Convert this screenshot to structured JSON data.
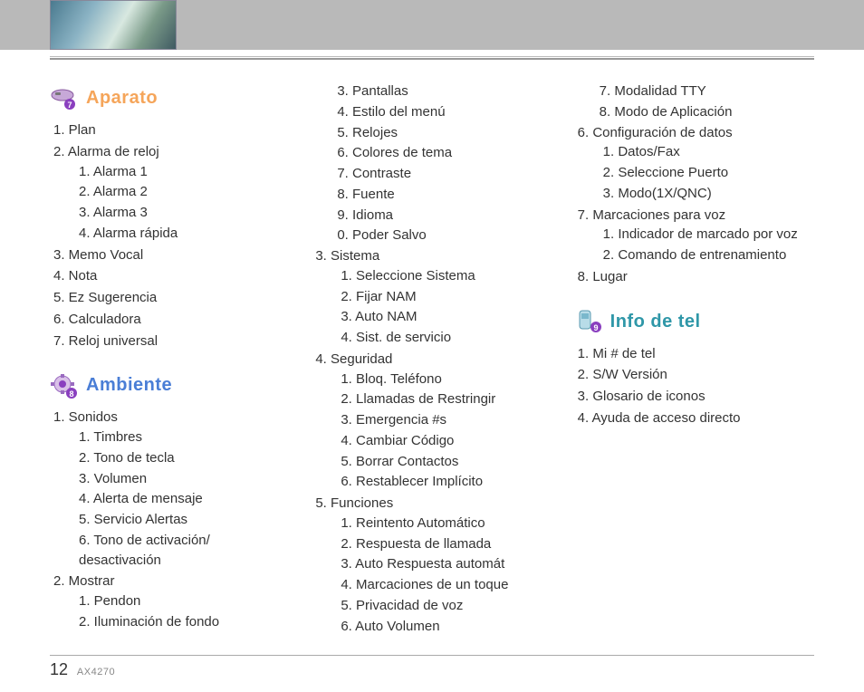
{
  "page_number": "12",
  "model": "AX4270",
  "sections": {
    "aparato": {
      "title": "Aparato",
      "items": [
        {
          "n": "1",
          "t": "Plan"
        },
        {
          "n": "2",
          "t": "Alarma de reloj",
          "sub": [
            {
              "n": "1",
              "t": "Alarma 1"
            },
            {
              "n": "2",
              "t": "Alarma 2"
            },
            {
              "n": "3",
              "t": "Alarma 3"
            },
            {
              "n": "4",
              "t": "Alarma rápida"
            }
          ]
        },
        {
          "n": "3",
          "t": "Memo Vocal"
        },
        {
          "n": "4",
          "t": "Nota"
        },
        {
          "n": "5",
          "t": "Ez Sugerencia"
        },
        {
          "n": "6",
          "t": "Calculadora"
        },
        {
          "n": "7",
          "t": "Reloj universal"
        }
      ]
    },
    "ambiente": {
      "title": "Ambiente",
      "items": [
        {
          "n": "1",
          "t": "Sonidos",
          "sub": [
            {
              "n": "1",
              "t": "Timbres"
            },
            {
              "n": "2",
              "t": "Tono de tecla"
            },
            {
              "n": "3",
              "t": "Volumen"
            },
            {
              "n": "4",
              "t": "Alerta de mensaje"
            },
            {
              "n": "5",
              "t": "Servicio Alertas"
            },
            {
              "n": "6",
              "t": "Tono de activación/ desactivación"
            }
          ]
        },
        {
          "n": "2",
          "t": "Mostrar",
          "sub": [
            {
              "n": "1",
              "t": "Pendon"
            },
            {
              "n": "2",
              "t": "Iluminación de fondo"
            }
          ]
        }
      ],
      "mostrar_cont": [
        {
          "n": "3",
          "t": "Pantallas"
        },
        {
          "n": "4",
          "t": "Estilo del menú"
        },
        {
          "n": "5",
          "t": "Relojes"
        },
        {
          "n": "6",
          "t": "Colores de tema"
        },
        {
          "n": "7",
          "t": "Contraste"
        },
        {
          "n": "8",
          "t": "Fuente"
        },
        {
          "n": "9",
          "t": "Idioma"
        },
        {
          "n": "0",
          "t": "Poder Salvo"
        }
      ],
      "col2": [
        {
          "n": "3",
          "t": "Sistema",
          "sub": [
            {
              "n": "1",
              "t": "Seleccione Sistema"
            },
            {
              "n": "2",
              "t": "Fijar NAM"
            },
            {
              "n": "3",
              "t": "Auto NAM"
            },
            {
              "n": "4",
              "t": "Sist. de servicio"
            }
          ]
        },
        {
          "n": "4",
          "t": "Seguridad",
          "sub": [
            {
              "n": "1",
              "t": "Bloq. Teléfono"
            },
            {
              "n": "2",
              "t": "Llamadas de Restringir"
            },
            {
              "n": "3",
              "t": "Emergencia #s"
            },
            {
              "n": "4",
              "t": "Cambiar Código"
            },
            {
              "n": "5",
              "t": "Borrar Contactos"
            },
            {
              "n": "6",
              "t": "Restablecer Implícito"
            }
          ]
        },
        {
          "n": "5",
          "t": "Funciones",
          "sub": [
            {
              "n": "1",
              "t": "Reintento Automático"
            },
            {
              "n": "2",
              "t": "Respuesta de llamada"
            },
            {
              "n": "3",
              "t": "Auto Respuesta automát"
            },
            {
              "n": "4",
              "t": "Marcaciones de un toque"
            },
            {
              "n": "5",
              "t": "Privacidad de voz"
            },
            {
              "n": "6",
              "t": "Auto Volumen"
            }
          ]
        }
      ],
      "funciones_cont": [
        {
          "n": "7",
          "t": "Modalidad TTY"
        },
        {
          "n": "8",
          "t": "Modo de Aplicación"
        }
      ],
      "col3": [
        {
          "n": "6",
          "t": "Configuración de datos",
          "sub": [
            {
              "n": "1",
              "t": "Datos/Fax"
            },
            {
              "n": "2",
              "t": "Seleccione Puerto"
            },
            {
              "n": "3",
              "t": "Modo(1X/QNC)"
            }
          ]
        },
        {
          "n": "7",
          "t": "Marcaciones para voz",
          "sub": [
            {
              "n": "1",
              "t": "Indicador de marcado por voz"
            },
            {
              "n": "2",
              "t": "Comando de entrenamiento"
            }
          ]
        },
        {
          "n": "8",
          "t": "Lugar"
        }
      ]
    },
    "info": {
      "title": "Info de tel",
      "items": [
        {
          "n": "1",
          "t": "Mi # de tel"
        },
        {
          "n": "2",
          "t": "S/W Versión"
        },
        {
          "n": "3",
          "t": "Glosario de iconos"
        },
        {
          "n": "4",
          "t": "Ayuda de acceso directo"
        }
      ]
    }
  }
}
